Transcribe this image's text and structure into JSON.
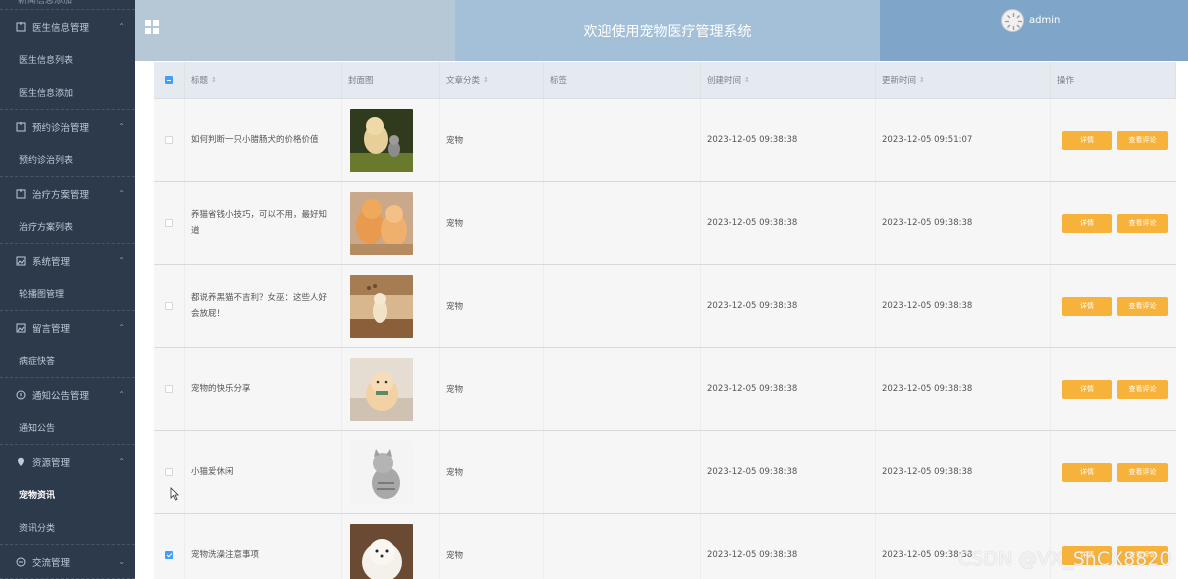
{
  "sidebar": {
    "top_fragment": "新闻信息添加",
    "groups": [
      {
        "label": "医生信息管理",
        "icon": "document-icon",
        "items": [
          "医生信息列表",
          "医生信息添加"
        ]
      },
      {
        "label": "预约诊治管理",
        "icon": "document-icon",
        "items": [
          "预约诊治列表"
        ]
      },
      {
        "label": "治疗方案管理",
        "icon": "document-icon",
        "items": [
          "治疗方案列表"
        ]
      },
      {
        "label": "系统管理",
        "icon": "image-icon",
        "items": [
          "轮播图管理"
        ]
      },
      {
        "label": "留言管理",
        "icon": "image-icon",
        "items": [
          "病症快答"
        ]
      },
      {
        "label": "通知公告管理",
        "icon": "info-circle-icon",
        "items": [
          "通知公告"
        ]
      },
      {
        "label": "资源管理",
        "icon": "location-icon",
        "items": [
          "宠物资讯",
          "资讯分类"
        ],
        "active_item": "宠物资讯"
      },
      {
        "label": "交流管理",
        "icon": "chat-icon",
        "items": []
      }
    ]
  },
  "header": {
    "title": "欢迎使用宠物医疗管理系统",
    "user": "admin"
  },
  "table": {
    "columns": {
      "title": "标题",
      "cover": "封面图",
      "category": "文章分类",
      "tags": "标签",
      "created": "创建时间",
      "updated": "更新时间",
      "ops": "操作"
    },
    "buttons": {
      "detail": "详情",
      "comments": "查看评论"
    },
    "rows": [
      {
        "title": "如何判断一只小腊肠犬的价格价值",
        "category": "宠物",
        "tags": "",
        "created": "2023-12-05 09:38:38",
        "updated": "2023-12-05 09:51:07",
        "checked": false,
        "cover": "puppy-and-kitten"
      },
      {
        "title": "养猫省钱小技巧，可以不用，最好知道",
        "category": "宠物",
        "tags": "",
        "created": "2023-12-05 09:38:38",
        "updated": "2023-12-05 09:38:38",
        "checked": false,
        "cover": "orange-cats"
      },
      {
        "title": "都说养黑猫不吉利？女巫：这些人好会放屁！",
        "category": "宠物",
        "tags": "",
        "created": "2023-12-05 09:38:38",
        "updated": "2023-12-05 09:38:38",
        "checked": false,
        "cover": "cat-in-room"
      },
      {
        "title": "宠物的快乐分享",
        "category": "宠物",
        "tags": "",
        "created": "2023-12-05 09:38:38",
        "updated": "2023-12-05 09:38:38",
        "checked": false,
        "cover": "pomeranian"
      },
      {
        "title": "小猫爱休闲",
        "category": "宠物",
        "tags": "",
        "created": "2023-12-05 09:38:38",
        "updated": "2023-12-05 09:38:38",
        "checked": false,
        "cover": "tabby-cat"
      },
      {
        "title": "宠物洗澡注意事项",
        "category": "宠物",
        "tags": "",
        "created": "2023-12-05 09:38:38",
        "updated": "2023-12-05 09:38:38",
        "checked": true,
        "cover": "white-puppy"
      }
    ]
  },
  "watermark": "CSDN @VX_ShCX8820"
}
